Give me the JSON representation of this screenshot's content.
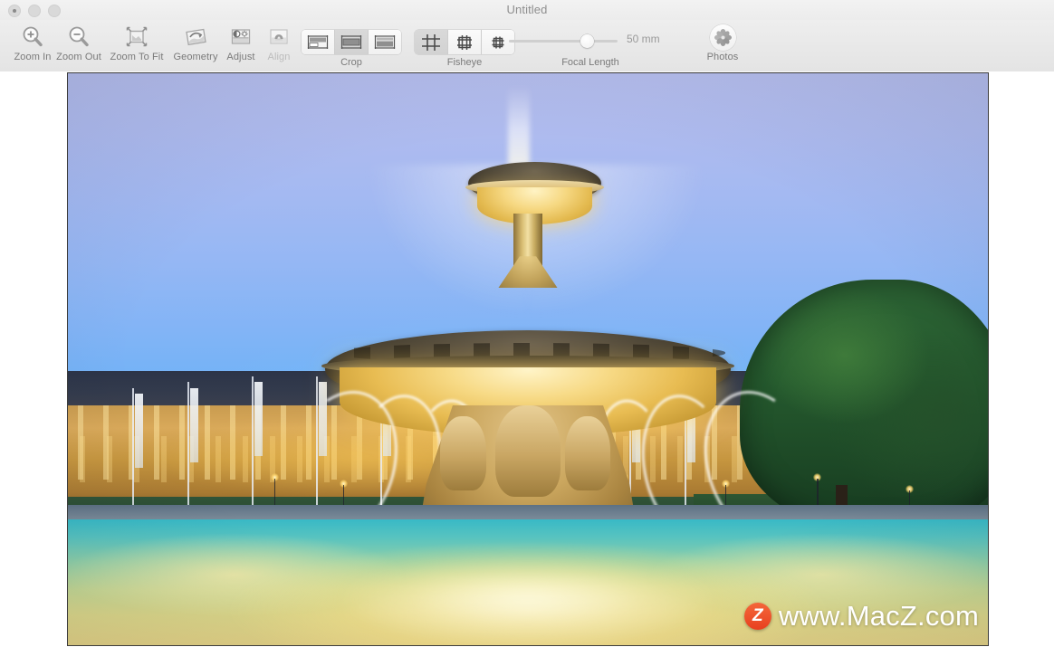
{
  "window": {
    "title": "Untitled",
    "traffic_lights": [
      "close",
      "minimize",
      "maximize"
    ]
  },
  "toolbar": {
    "items": [
      {
        "name": "zoom-in",
        "label": "Zoom In",
        "icon": "magnifier-plus-icon",
        "enabled": true
      },
      {
        "name": "zoom-out",
        "label": "Zoom Out",
        "icon": "magnifier-minus-icon",
        "enabled": true
      },
      {
        "name": "zoom-to-fit",
        "label": "Zoom To Fit",
        "icon": "fit-image-icon",
        "enabled": true
      },
      {
        "name": "geometry",
        "label": "Geometry",
        "icon": "geometry-icon",
        "enabled": true
      },
      {
        "name": "adjust",
        "label": "Adjust",
        "icon": "adjust-icon",
        "enabled": true
      },
      {
        "name": "align",
        "label": "Align",
        "icon": "align-icon",
        "enabled": false
      }
    ],
    "crop": {
      "label": "Crop",
      "options": [
        "crop-top",
        "crop-middle",
        "crop-bottom"
      ],
      "selected_index": 1
    },
    "fisheye": {
      "label": "Fisheye",
      "options": [
        "grid-full",
        "grid-medium",
        "grid-small"
      ],
      "selected_index": 0
    },
    "focal_length": {
      "label": "Focal Length",
      "value": "50 mm",
      "slider_percent": 66
    },
    "photos": {
      "label": "Photos",
      "icon": "photos-flower-icon"
    }
  },
  "canvas": {
    "image_alt": "Evening photo of an illuminated baroque fountain with palace in background",
    "watermark": {
      "logo_letter": "Z",
      "text": "www.MacZ.com",
      "logo_color": "#e8401f"
    }
  }
}
